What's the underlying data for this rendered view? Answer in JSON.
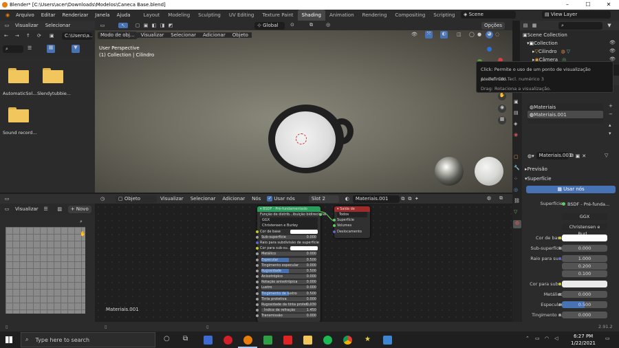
{
  "window": {
    "title": "Blender* [C:\\Users\\acer\\Downloads\\Modelos\\Caneca Base.blend]"
  },
  "menu": [
    "Arquivo",
    "Editar",
    "Renderizar",
    "Janela",
    "Ajuda"
  ],
  "workspaces": [
    "Layout",
    "Modeling",
    "Sculpting",
    "UV Editing",
    "Texture Paint",
    "Shading",
    "Animation",
    "Rendering",
    "Compositing",
    "Scripting"
  ],
  "active_workspace": "Shading",
  "scene": {
    "scene_name": "Scene",
    "view_layer": "View Layer"
  },
  "file_browser": {
    "menu": [
      "Visualizar",
      "Selecionar"
    ],
    "path": "C:\\Users\\a...",
    "items": [
      {
        "label": "AutomaticSol..."
      },
      {
        "label": "Slendytubbie..."
      },
      {
        "label": "Sound record..."
      }
    ]
  },
  "viewport": {
    "mode": "Modo de obj...",
    "menu": [
      "Visualizar",
      "Selecionar",
      "Adicionar",
      "Objeto"
    ],
    "orientation": "Global",
    "options": "Opções",
    "perspective": "User Perspective",
    "collection_info": "(1) Collection | Cilindro"
  },
  "tooltip": {
    "line1": "Click: Permite o uso de um ponto de visualização predefinido.",
    "line2": "Atalho: Ctrl Tecl. numérico 3",
    "line3": "Drag: Rotaciona a visualização."
  },
  "outliner": {
    "root": "Scene Collection",
    "collection": "Collection",
    "objects": [
      "Cilindro",
      "Câmera"
    ]
  },
  "image_editor": {
    "view": "Visualizar",
    "new_button": "Novo"
  },
  "node_editor": {
    "object_type": "Objeto",
    "menu": [
      "Visualizar",
      "Selecionar",
      "Adicionar",
      "Nós"
    ],
    "use_nodes": "Usar nós",
    "slot": "Slot 2",
    "material": "Materiais.001",
    "label": "Materiais.001",
    "bsdf": {
      "title": "BSDF - Pré-fundamentado",
      "dist_label": "Função de distrib...ibuição bidirecional",
      "dist": "GGX",
      "sss_method": "Christensen e Burley",
      "rows": [
        {
          "label": "Cor de base",
          "value": ""
        },
        {
          "label": "Sub-superfície",
          "value": "0.000"
        },
        {
          "label": "Raio para subdivisão de superfície",
          "value": ""
        },
        {
          "label": "Cor para sub-su...",
          "value": ""
        },
        {
          "label": "Metálico",
          "value": "0.000"
        },
        {
          "label": "Especular",
          "value": "0.500"
        },
        {
          "label": "Tingimento especular",
          "value": "0.000"
        },
        {
          "label": "Rugosidade",
          "value": "0.500"
        },
        {
          "label": "Anisotrópico",
          "value": "0.000"
        },
        {
          "label": "Rotação anisotrópica",
          "value": "0.000"
        },
        {
          "label": "Lustro",
          "value": "0.000"
        },
        {
          "label": "Tingimento de lustro",
          "value": "0.500"
        },
        {
          "label": "Tinta protetiva",
          "value": "0.000"
        },
        {
          "label": "Rugosidade da tinta protet...",
          "value": "0.030"
        },
        {
          "label": "Índice de refração",
          "value": "1.450"
        },
        {
          "label": "Transmissão",
          "value": "0.000"
        }
      ]
    },
    "output": {
      "title": "Saída de material",
      "target": "Todos",
      "sockets": [
        "Superfície",
        "Volumes",
        "Deslocamento"
      ]
    }
  },
  "properties": {
    "materials": [
      "Materiais",
      "Materiais.001"
    ],
    "active_material": "Materiais.001",
    "preview": "Previsão",
    "surface_panel": "Superfície",
    "use_nodes": "Usar nós",
    "surface_label": "Superfície",
    "surface_value": "BSDF - Pré-funda...",
    "distribution": "GGX",
    "sss_method": "Christensen e Burl...",
    "fields": [
      {
        "label": "Cor de base",
        "value": ""
      },
      {
        "label": "Sub-superfície",
        "value": "0.000"
      },
      {
        "label": "Raio para su...",
        "value": "1.000"
      },
      {
        "label": "",
        "value": "0.200"
      },
      {
        "label": "",
        "value": "0.100"
      },
      {
        "label": "Cor para sub...",
        "value": ""
      },
      {
        "label": "Metálico",
        "value": "0.000"
      },
      {
        "label": "Especular",
        "value": "0.500"
      },
      {
        "label": "Tingimento ...",
        "value": "0.000"
      }
    ],
    "version": "2.91.2"
  },
  "taskbar": {
    "search_placeholder": "Type here to search",
    "time": "6:27 PM",
    "date": "1/22/2021"
  },
  "colors": {
    "accent": "#4772b3",
    "active_ws": "#474747",
    "bsdf_header": "#2c9c5c",
    "output_header": "#9c2c2c"
  }
}
